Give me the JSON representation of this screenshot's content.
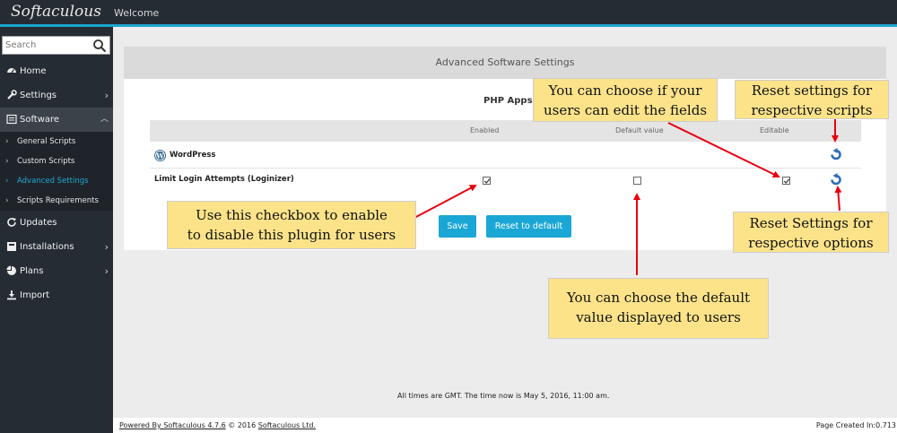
{
  "app": {
    "logo": "Softaculous",
    "welcome": "Welcome"
  },
  "search": {
    "placeholder": "Search"
  },
  "nav": {
    "home": "Home",
    "settings": "Settings",
    "software": "Software",
    "updates": "Updates",
    "installations": "Installations",
    "plans": "Plans",
    "import": "Import"
  },
  "subnav": {
    "general": "General Scripts",
    "custom": "Custom Scripts",
    "advanced": "Advanced Settings",
    "requirements": "Scripts Requirements"
  },
  "panel": {
    "title": "Advanced Software Settings",
    "section": "PHP Apps",
    "col_enabled": "Enabled",
    "col_default": "Default value",
    "col_editable": "Editable",
    "app_name": "WordPress",
    "option_name": "Limit Login Attempts (Loginizer)",
    "enabled_checked": true,
    "default_checked": false,
    "editable_checked": true,
    "save_label": "Save",
    "reset_label": "Reset to default"
  },
  "footer": {
    "time_note": "All times are GMT. The time now is May 5, 2016, 11:00 am.",
    "powered_link": "Powered By Softaculous 4.7.6",
    "copyright_mid": " © 2016 ",
    "company_link": "Softaculous Ltd.",
    "page_created": "Page Created In:0.713"
  },
  "callouts": {
    "editable_line1": "You can choose if your",
    "editable_line2": "users can edit the fields",
    "reset_scripts_line1": "Reset settings for",
    "reset_scripts_line2": "respective scripts",
    "enable_line1": "Use this checkbox to enable",
    "enable_line2": "to disable this plugin for users",
    "reset_options_line1": "Reset Settings for",
    "reset_options_line2": "respective options",
    "default_line1": "You can choose the default",
    "default_line2": "value displayed to users"
  },
  "colors": {
    "accent": "#1ba7d6",
    "sidebar": "#262c34",
    "callout": "#fce38a",
    "arrow": "#e8000e"
  }
}
